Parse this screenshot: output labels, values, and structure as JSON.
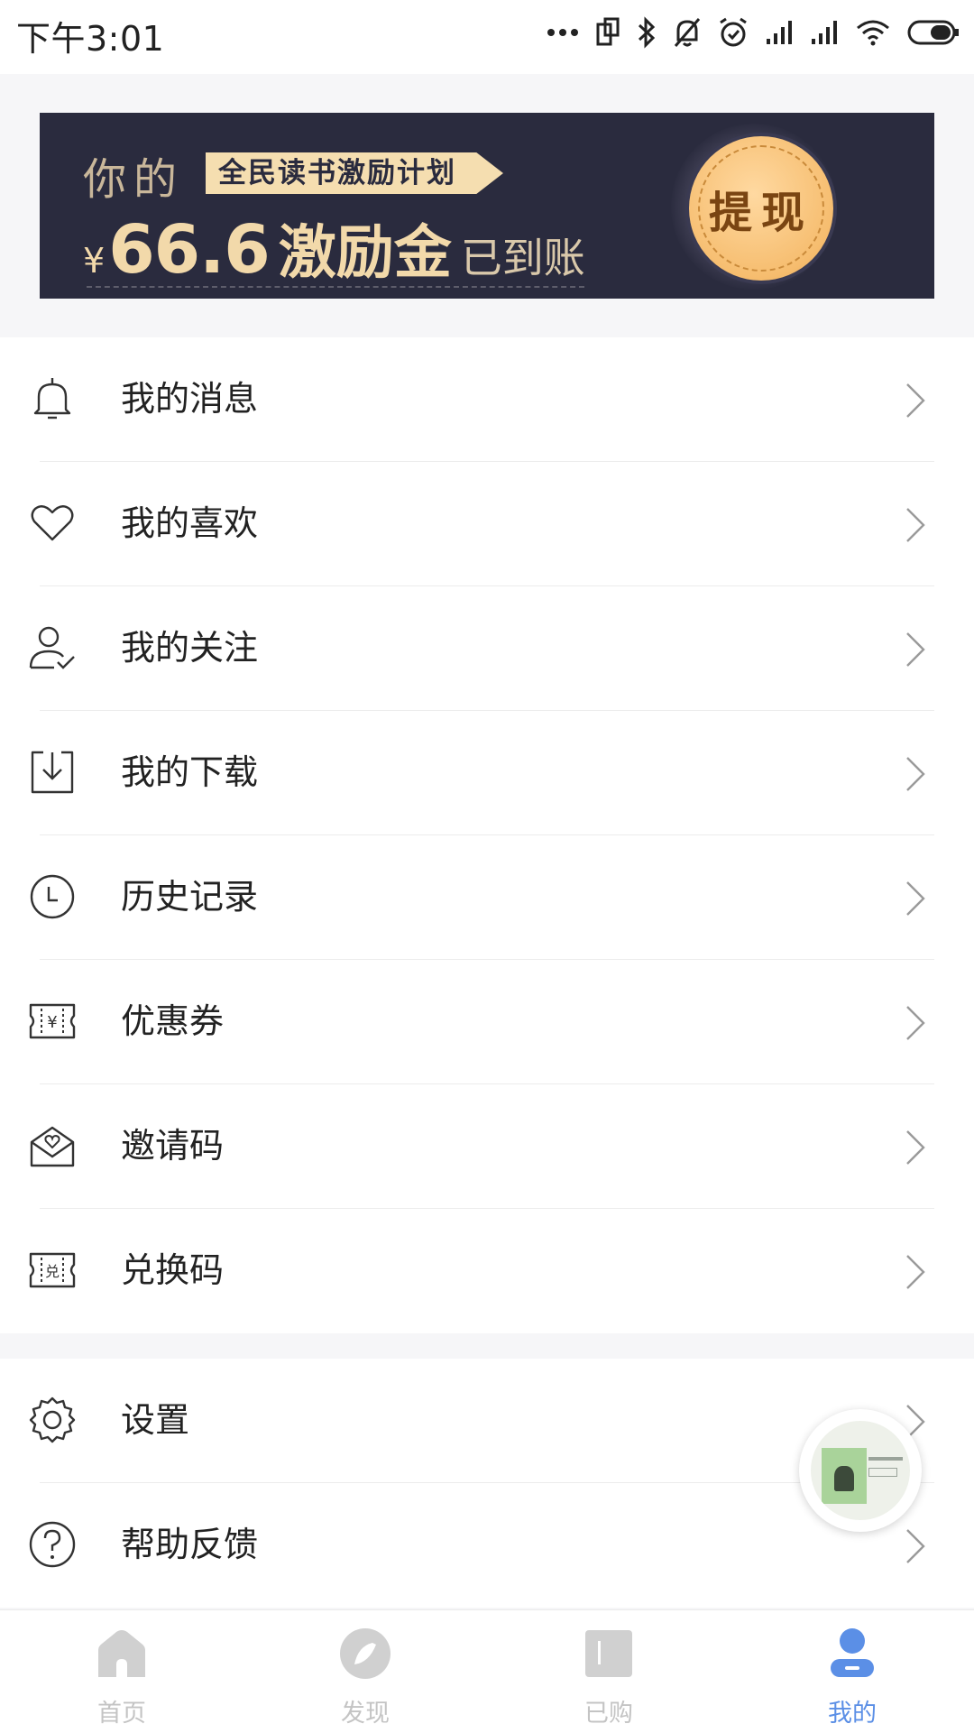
{
  "status_bar": {
    "time": "下午3:01",
    "icons": [
      "more-dots-icon",
      "screen-rotate-icon",
      "bluetooth-icon",
      "mute-icon",
      "alarm-icon",
      "signal-icon",
      "signal-icon",
      "wifi-icon",
      "battery-icon"
    ]
  },
  "banner": {
    "lead": "你的",
    "tag": "全民读书激励计划",
    "currency": "¥",
    "amount": "66.6",
    "reward": "激励金",
    "arrived": "已到账",
    "withdraw": "提现",
    "colors": {
      "background": "#2a2b3e",
      "gold": "#f2d9aa",
      "coin": "#f6bd6f"
    }
  },
  "menu_main": [
    {
      "label": "我的消息",
      "icon": "bell-icon"
    },
    {
      "label": "我的喜欢",
      "icon": "heart-icon"
    },
    {
      "label": "我的关注",
      "icon": "user-follow-icon"
    },
    {
      "label": "我的下载",
      "icon": "download-icon"
    },
    {
      "label": "历史记录",
      "icon": "clock-icon"
    },
    {
      "label": "优惠券",
      "icon": "coupon-icon"
    },
    {
      "label": "邀请码",
      "icon": "invite-envelope-icon"
    },
    {
      "label": "兑换码",
      "icon": "redeem-icon"
    }
  ],
  "menu_secondary": [
    {
      "label": "设置",
      "icon": "gear-icon"
    },
    {
      "label": "帮助反馈",
      "icon": "help-icon"
    }
  ],
  "tabs": [
    {
      "label": "首页",
      "icon": "home-icon",
      "active": false
    },
    {
      "label": "发现",
      "icon": "discover-icon",
      "active": false
    },
    {
      "label": "已购",
      "icon": "purchased-icon",
      "active": false
    },
    {
      "label": "我的",
      "icon": "profile-icon",
      "active": true
    }
  ],
  "colors": {
    "accent": "#5b8fe6",
    "inactive": "#c4c4c4",
    "text": "#222222"
  }
}
